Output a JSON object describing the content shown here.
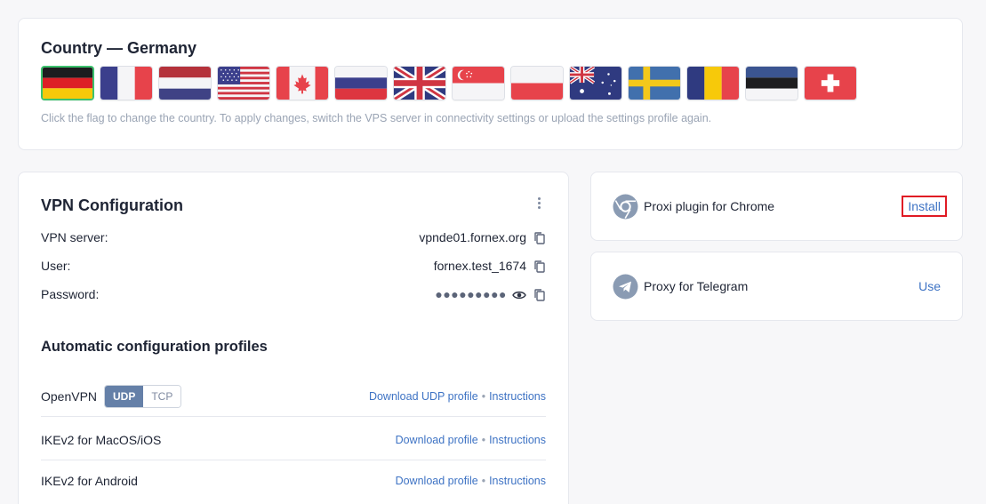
{
  "country": {
    "title": "Country — Germany",
    "hint": "Click the flag to change the country. To apply changes, switch the VPS server in connectivity settings or upload the settings profile again.",
    "flags": [
      "germany-flag",
      "france-flag",
      "netherlands-flag",
      "usa-flag",
      "canada-flag",
      "russia-flag",
      "uk-flag",
      "singapore-flag",
      "poland-flag",
      "australia-flag",
      "sweden-flag",
      "romania-flag",
      "estonia-flag",
      "switzerland-flag"
    ],
    "selected": "germany-flag"
  },
  "vpn": {
    "title": "VPN Configuration",
    "server_label": "VPN server:",
    "server_value": "vpnde01.fornex.org",
    "user_label": "User:",
    "user_value": "fornex.test_1674",
    "password_label": "Password:",
    "password_value": "●●●●●●●●●"
  },
  "profiles": {
    "title": "Automatic configuration profiles",
    "rows": [
      {
        "name": "OpenVPN",
        "download": "Download UDP profile",
        "instructions": "Instructions"
      },
      {
        "name": "IKEv2 for MacOS/iOS",
        "download": "Download profile",
        "instructions": "Instructions"
      },
      {
        "name": "IKEv2 for Android",
        "download": "Download profile",
        "instructions": "Instructions"
      }
    ],
    "protocol_udp": "UDP",
    "protocol_tcp": "TCP",
    "separator": "•"
  },
  "chrome": {
    "label": "Proxi plugin for Chrome",
    "action": "Install"
  },
  "telegram": {
    "label": "Proxy for Telegram",
    "action": "Use"
  },
  "colors": {
    "accent": "#3e73c4",
    "selected_border": "#3cc26d",
    "highlight": "#e01b24"
  }
}
